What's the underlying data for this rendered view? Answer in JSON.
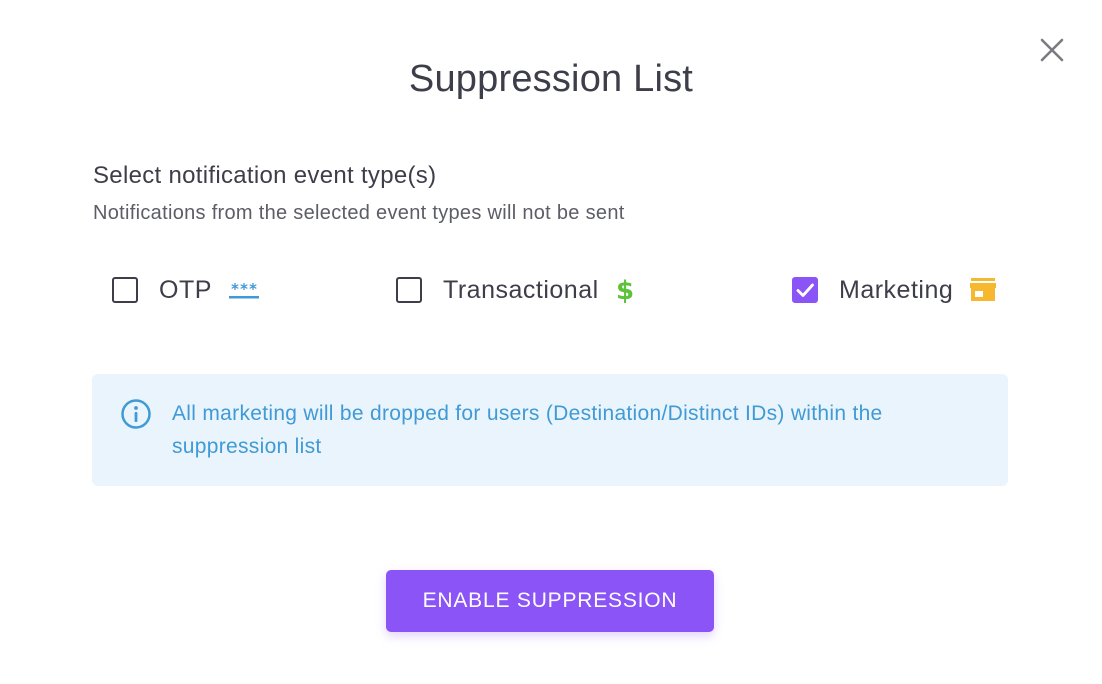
{
  "dialog": {
    "title": "Suppression List",
    "close_icon": "close-icon"
  },
  "section": {
    "heading": "Select notification event type(s)",
    "subtext": "Notifications from the selected event types will not be sent"
  },
  "options": [
    {
      "label": "OTP",
      "checked": false,
      "icon": "asterisks-icon",
      "icon_text": "***",
      "icon_color": "#3f9ad6"
    },
    {
      "label": "Transactional",
      "checked": false,
      "icon": "dollar-icon",
      "icon_text": "$",
      "icon_color": "#5cc23a"
    },
    {
      "label": "Marketing",
      "checked": true,
      "icon": "storefront-icon",
      "icon_color": "#f5b82e"
    }
  ],
  "info": {
    "icon": "info-icon",
    "text": "All marketing will be dropped for users (Destination/Distinct IDs) within the suppression list",
    "background": "#eaf4fc",
    "text_color": "#3f9ad6"
  },
  "actions": {
    "primary_label": "ENABLE SUPPRESSION",
    "primary_color": "#8b54f7"
  }
}
